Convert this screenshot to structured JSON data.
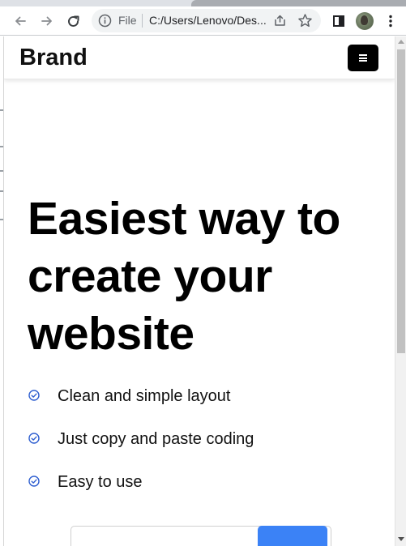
{
  "browser": {
    "omnibox": {
      "scheme_label": "File",
      "url": "C:/Users/Lenovo/Des..."
    },
    "icons": {
      "back": "arrow-left-icon",
      "forward": "arrow-right-icon",
      "reload": "reload-icon",
      "info": "info-icon",
      "share": "share-icon",
      "bookmark": "star-icon",
      "side_panel": "side-panel-icon",
      "profile": "avatar",
      "menu": "more-vertical-icon"
    }
  },
  "site": {
    "brand": "Brand",
    "nav_toggle_icon": "hamburger-menu-icon",
    "hero": {
      "title": "Easiest way to create your website"
    },
    "features": [
      {
        "icon": "check-circle-icon",
        "label": "Clean and simple layout"
      },
      {
        "icon": "check-circle-icon",
        "label": "Just copy and paste coding"
      },
      {
        "icon": "check-circle-icon",
        "label": "Easy to use"
      }
    ],
    "form": {
      "email_value": "",
      "submit_label": ""
    }
  },
  "colors": {
    "accent_blue": "#3b82f6",
    "check_icon": "#2f5fd0",
    "nav_toggle_bg": "#000000",
    "chrome_bg": "#dee1e6",
    "omnibox_bg": "#f1f3f4"
  }
}
